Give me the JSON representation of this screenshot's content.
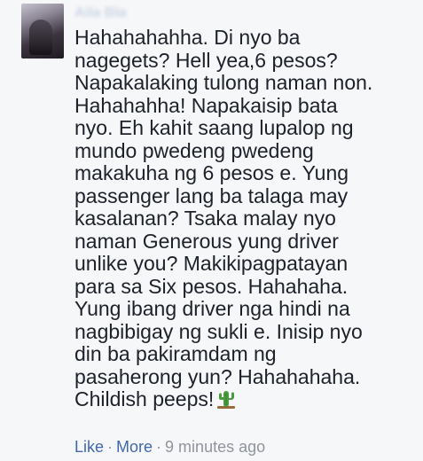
{
  "comment": {
    "author_name": "Aila Bla",
    "text": "Hahahahahha. Di nyo ba\nnagegets? Hell yea,6 pesos?\nNapakalaking tulong naman non.\nHahahahha! Napakaisip bata\nnyo. Eh kahit saang lupalop ng\nmundo pwedeng pwedeng\nmakakuha ng 6 pesos e. Yung\npassenger lang ba talaga may\nkasalanan? Tsaka malay nyo\nnaman Generous yung driver\nunlike you? Makikipagpatayan\npara sa Six pesos. Hahahaha.\nYung ibang driver nga hindi na\nnagbibigay ng sukli e. Inisip nyo\ndin ba pakiramdam ng\npasaherong yun? Hahahahaha.\nChildish peeps!",
    "emoji_icon": "cactus-icon"
  },
  "footer": {
    "like_label": "Like",
    "separator": "·",
    "more_label": "More",
    "timestamp": "9 minutes ago"
  },
  "colors": {
    "link": "#4267b2",
    "meta": "#90949c",
    "text": "#1d2129",
    "background": "#f6f7f9"
  }
}
